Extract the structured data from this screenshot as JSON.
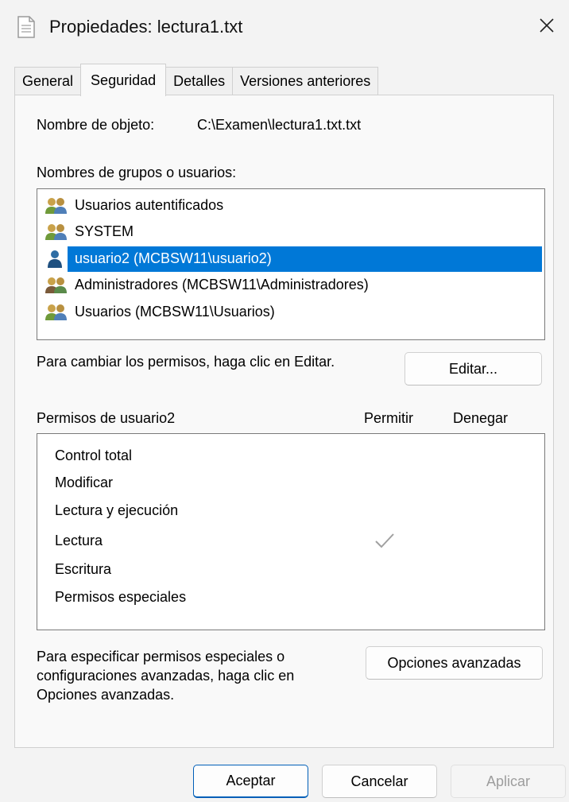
{
  "window": {
    "title": "Propiedades: lectura1.txt"
  },
  "tabs": [
    {
      "label": "General",
      "active": false
    },
    {
      "label": "Seguridad",
      "active": true
    },
    {
      "label": "Detalles",
      "active": false
    },
    {
      "label": "Versiones anteriores",
      "active": false
    }
  ],
  "object": {
    "label": "Nombre de objeto:",
    "value": "C:\\Examen\\lectura1.txt.txt"
  },
  "groups": {
    "label": "Nombres de grupos o usuarios:",
    "items": [
      {
        "name": "Usuarios autentificados",
        "icon": "users-group-icon",
        "selected": false
      },
      {
        "name": "SYSTEM",
        "icon": "users-group-icon",
        "selected": false
      },
      {
        "name": "usuario2 (MCBSW11\\usuario2)",
        "icon": "single-user-icon",
        "selected": true
      },
      {
        "name": "Administradores (MCBSW11\\Administradores)",
        "icon": "users-group-icon",
        "selected": false
      },
      {
        "name": "Usuarios (MCBSW11\\Usuarios)",
        "icon": "users-group-icon",
        "selected": false
      }
    ]
  },
  "edit": {
    "hint": "Para cambiar los permisos, haga clic en Editar.",
    "button": "Editar..."
  },
  "permissions": {
    "label": "Permisos de usuario2",
    "allow_header": "Permitir",
    "deny_header": "Denegar",
    "rows": [
      {
        "name": "Control total",
        "allow": false,
        "deny": false
      },
      {
        "name": "Modificar",
        "allow": false,
        "deny": false
      },
      {
        "name": "Lectura y ejecución",
        "allow": false,
        "deny": false
      },
      {
        "name": "Lectura",
        "allow": true,
        "deny": false
      },
      {
        "name": "Escritura",
        "allow": false,
        "deny": false
      },
      {
        "name": "Permisos especiales",
        "allow": false,
        "deny": false
      }
    ]
  },
  "advanced": {
    "hint": "Para especificar permisos especiales o configuraciones avanzadas, haga clic en Opciones avanzadas.",
    "button": "Opciones avanzadas"
  },
  "footer": {
    "ok": "Aceptar",
    "cancel": "Cancelar",
    "apply": "Aplicar"
  },
  "colors": {
    "selection": "#0078d7",
    "default_button_border": "#005fb8",
    "check": "#a0a0a0"
  }
}
